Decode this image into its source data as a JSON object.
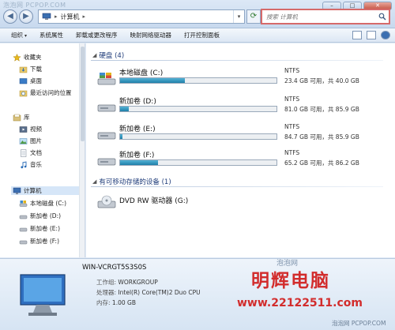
{
  "watermark_top": "泡泡网 PCPOP.COM",
  "window_controls": {
    "minimize": "–",
    "maximize": "□",
    "close": "✕"
  },
  "address": {
    "location": "计算机",
    "separator": "▸"
  },
  "search": {
    "placeholder": "搜索 计算机"
  },
  "toolbar": {
    "items": [
      "组织",
      "系统属性",
      "卸载或更改程序",
      "映射网络驱动器",
      "打开控制面板"
    ]
  },
  "nav": {
    "favorites": {
      "label": "收藏夹",
      "items": [
        "下载",
        "桌面",
        "最近访问的位置"
      ]
    },
    "libraries": {
      "label": "库",
      "items": [
        "视频",
        "图片",
        "文档",
        "音乐"
      ]
    },
    "computer": {
      "label": "计算机",
      "items": [
        "本地磁盘 (C:)",
        "新加卷 (D:)",
        "新加卷 (E:)",
        "新加卷 (F:)"
      ]
    }
  },
  "content": {
    "hdd_group": "硬盘 (4)",
    "drives": [
      {
        "name": "本地磁盘 (C:)",
        "fs": "NTFS",
        "capacity": "23.4 GB 可用，共 40.0 GB",
        "used_fraction": 0.415
      },
      {
        "name": "新加卷 (D:)",
        "fs": "NTFS",
        "capacity": "81.0 GB 可用，共 85.9 GB",
        "used_fraction": 0.057
      },
      {
        "name": "新加卷 (E:)",
        "fs": "NTFS",
        "capacity": "84.7 GB 可用，共 85.9 GB",
        "used_fraction": 0.014
      },
      {
        "name": "新加卷 (F:)",
        "fs": "NTFS",
        "capacity": "65.2 GB 可用，共 86.2 GB",
        "used_fraction": 0.244
      }
    ],
    "removable_group": "有可移动存储的设备 (1)",
    "dvd": {
      "name": "DVD RW 驱动器 (G:)"
    }
  },
  "details": {
    "pc_name": "WIN-VCRGT5S3S0S",
    "workgroup_label": "工作组:",
    "workgroup": "WORKGROUP",
    "cpu_label": "处理器:",
    "cpu": "Intel(R) Core(TM)2 Duo CPU",
    "memory_label": "内存:",
    "memory": "1.00 GB"
  },
  "overlay": {
    "brand": "明辉电脑",
    "url": "www.22122511.com",
    "footer": "泡泡网 PCPOP.COM",
    "mid": "泡泡网"
  },
  "colors": {
    "accent": "#1f3c7a",
    "brand_red": "#d22c2c",
    "bar_fill": "#2a8dbb"
  }
}
